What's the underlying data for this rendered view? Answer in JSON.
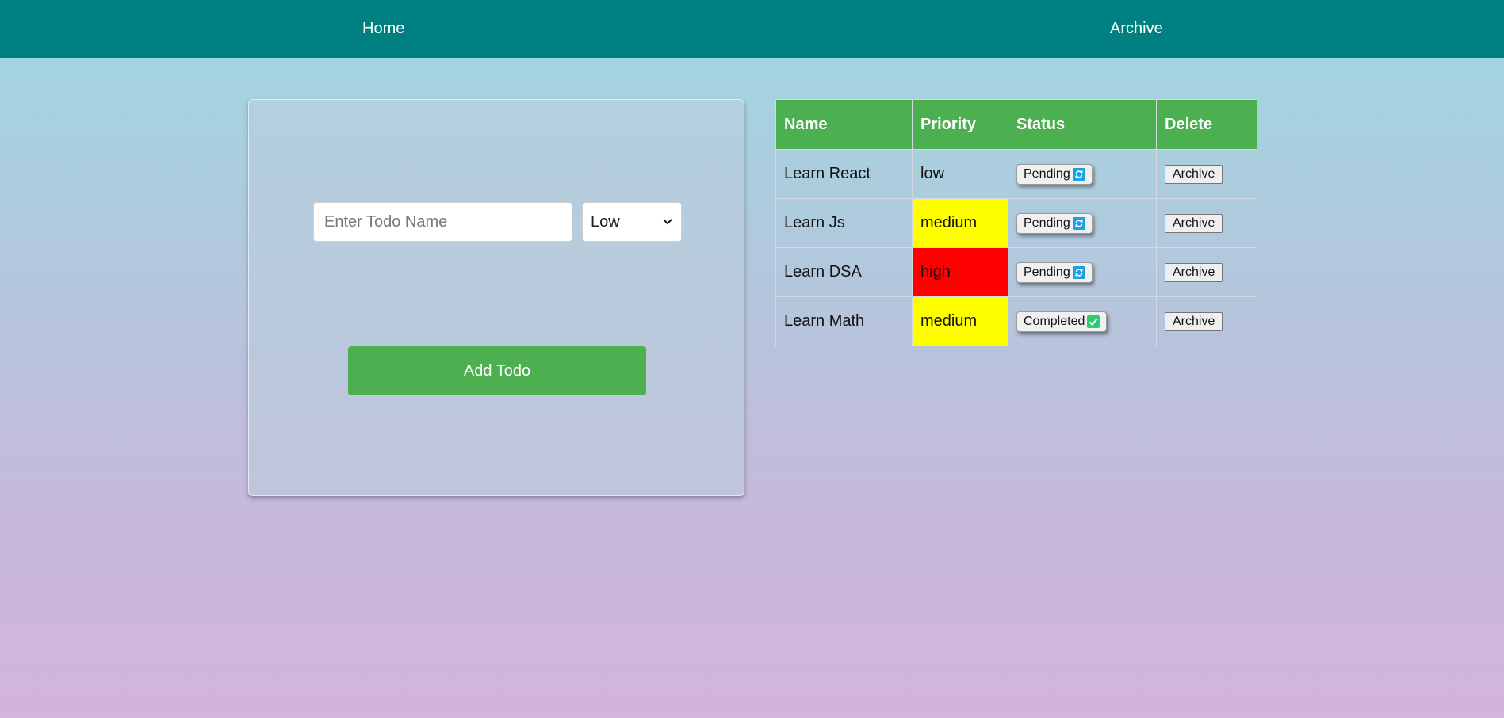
{
  "nav": {
    "home_label": "Home",
    "archive_label": "Archive"
  },
  "form": {
    "input_placeholder": "Enter Todo Name",
    "input_value": "",
    "priority_selected": "Low",
    "add_button_label": "Add Todo"
  },
  "table": {
    "headers": [
      "Name",
      "Priority",
      "Status",
      "Delete"
    ],
    "rows": [
      {
        "name": "Learn React",
        "priority": "low",
        "priority_color": "transparent",
        "status": "Pending",
        "status_icon": "refresh-icon",
        "delete_label": "Archive"
      },
      {
        "name": "Learn Js",
        "priority": "medium",
        "priority_color": "#ffff00",
        "status": "Pending",
        "status_icon": "refresh-icon",
        "delete_label": "Archive"
      },
      {
        "name": "Learn DSA",
        "priority": "high",
        "priority_color": "#ff0000",
        "status": "Pending",
        "status_icon": "refresh-icon",
        "delete_label": "Archive"
      },
      {
        "name": "Learn Math",
        "priority": "medium",
        "priority_color": "#ffff00",
        "status": "Completed",
        "status_icon": "check-icon",
        "delete_label": "Archive"
      }
    ]
  },
  "colors": {
    "navbar": "#008080",
    "header_green": "#4caf50",
    "pending_icon": "#1ba1e2",
    "completed_icon": "#2ecc71"
  }
}
